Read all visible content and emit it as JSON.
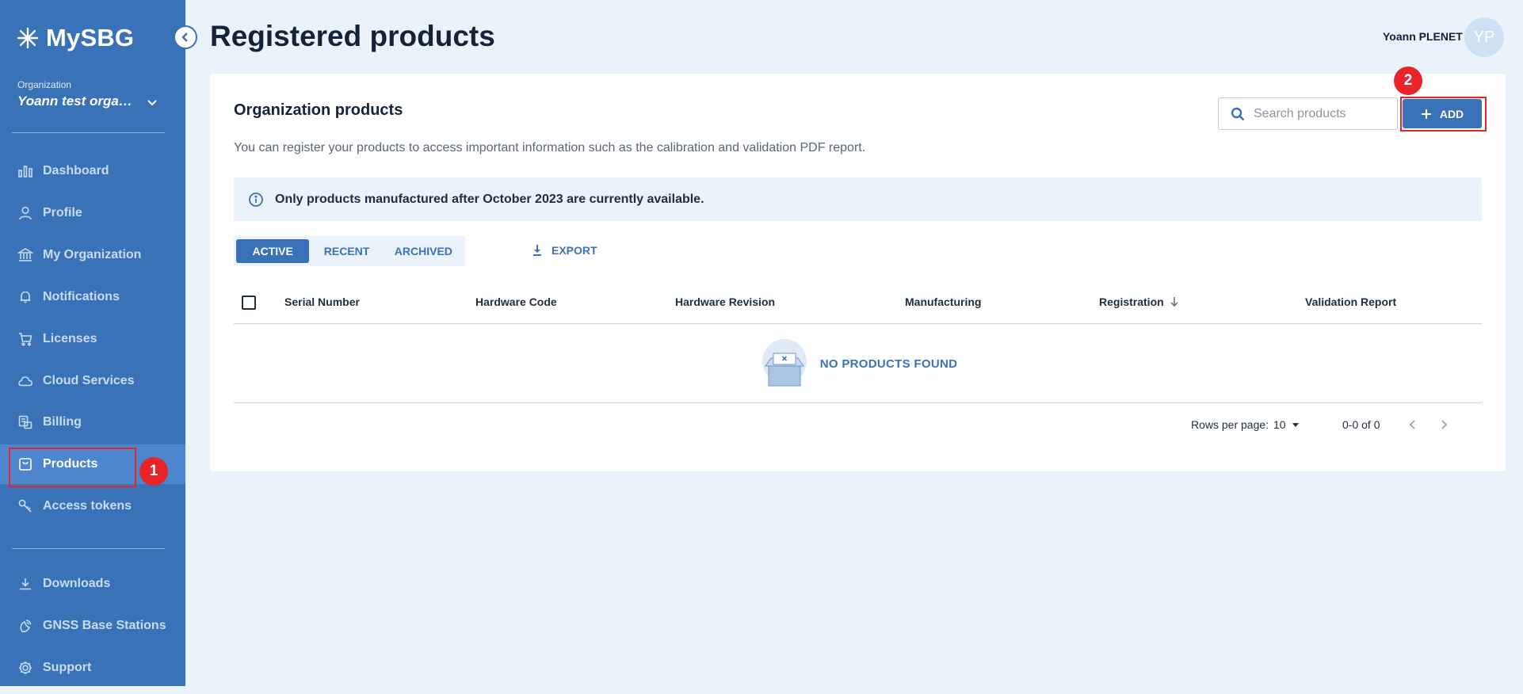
{
  "app": {
    "logo_text": "MySBG"
  },
  "organization": {
    "label": "Organization",
    "name": "Yoann test organization"
  },
  "sidebar": {
    "items": [
      {
        "label": "Dashboard",
        "icon": "chart-icon"
      },
      {
        "label": "Profile",
        "icon": "user-icon"
      },
      {
        "label": "My Organization",
        "icon": "bank-icon"
      },
      {
        "label": "Notifications",
        "icon": "bell-icon"
      },
      {
        "label": "Licenses",
        "icon": "cart-icon"
      },
      {
        "label": "Cloud Services",
        "icon": "cloud-icon"
      },
      {
        "label": "Billing",
        "icon": "billing-icon"
      },
      {
        "label": "Products",
        "icon": "bag-icon",
        "active": true
      },
      {
        "label": "Access tokens",
        "icon": "key-icon"
      }
    ],
    "bottom_items": [
      {
        "label": "Downloads",
        "icon": "download-icon"
      },
      {
        "label": "GNSS Base Stations",
        "icon": "satellite-icon"
      },
      {
        "label": "Support",
        "icon": "gear-icon"
      }
    ]
  },
  "header": {
    "title": "Registered products",
    "user_name": "Yoann PLENET",
    "user_initials": "YP"
  },
  "card": {
    "title": "Organization products",
    "description": "You can register your products to access important information such as the calibration and validation PDF report.",
    "search_placeholder": "Search products",
    "add_label": "ADD",
    "info_text": "Only products manufactured after October 2023 are currently available."
  },
  "tabs": [
    "ACTIVE",
    "RECENT",
    "ARCHIVED"
  ],
  "export_label": "EXPORT",
  "table": {
    "columns": [
      "Serial Number",
      "Hardware Code",
      "Hardware Revision",
      "Manufacturing",
      "Registration",
      "Validation Report"
    ],
    "empty_text": "NO PRODUCTS FOUND"
  },
  "pagination": {
    "rows_label": "Rows per page:",
    "rows_value": "10",
    "range": "0-0 of 0"
  },
  "annotations": {
    "step1": "1",
    "step2": "2"
  },
  "colors": {
    "sidebar": "#3a72b8",
    "accent": "#3a72b8",
    "highlight": "#e8242b",
    "page_bg": "#eaf2fb"
  }
}
